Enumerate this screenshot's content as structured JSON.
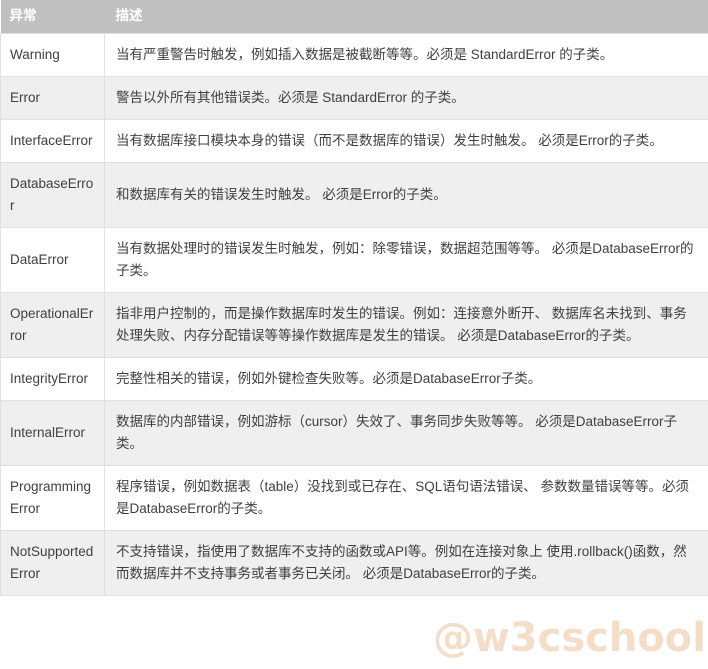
{
  "table": {
    "headers": {
      "exception": "异常",
      "description": "描述"
    },
    "rows": [
      {
        "exception": "Warning",
        "description": "当有严重警告时触发，例如插入数据是被截断等等。必须是 StandardError 的子类。"
      },
      {
        "exception": "Error",
        "description": "警告以外所有其他错误类。必须是 StandardError 的子类。"
      },
      {
        "exception": "InterfaceError",
        "description": "当有数据库接口模块本身的错误（而不是数据库的错误）发生时触发。 必须是Error的子类。"
      },
      {
        "exception": "DatabaseError",
        "description": "和数据库有关的错误发生时触发。 必须是Error的子类。"
      },
      {
        "exception": "DataError",
        "description": "当有数据处理时的错误发生时触发，例如：除零错误，数据超范围等等。 必须是DatabaseError的子类。"
      },
      {
        "exception": "OperationalError",
        "description": "指非用户控制的，而是操作数据库时发生的错误。例如：连接意外断开、 数据库名未找到、事务处理失败、内存分配错误等等操作数据库是发生的错误。 必须是DatabaseError的子类。"
      },
      {
        "exception": "IntegrityError",
        "description": "完整性相关的错误，例如外键检查失败等。必须是DatabaseError子类。"
      },
      {
        "exception": "InternalError",
        "description": "数据库的内部错误，例如游标（cursor）失效了、事务同步失败等等。 必须是DatabaseError子类。"
      },
      {
        "exception": "ProgrammingError",
        "description": "程序错误，例如数据表（table）没找到或已存在、SQL语句语法错误、 参数数量错误等等。必须是DatabaseError的子类。"
      },
      {
        "exception": "NotSupportedError",
        "description": "不支持错误，指使用了数据库不支持的函数或API等。例如在连接对象上 使用.rollback()函数，然而数据库并不支持事务或者事务已关闭。 必须是DatabaseError的子类。"
      }
    ]
  },
  "watermark": {
    "text": "@w3cschool"
  },
  "colors": {
    "header_background": "#c0c0c0",
    "header_text": "#ffffff",
    "row_even_background": "#efefef",
    "row_odd_background": "#ffffff",
    "border": "#e0e0e0",
    "body_text": "#404040",
    "watermark": "#f0d9c0"
  }
}
